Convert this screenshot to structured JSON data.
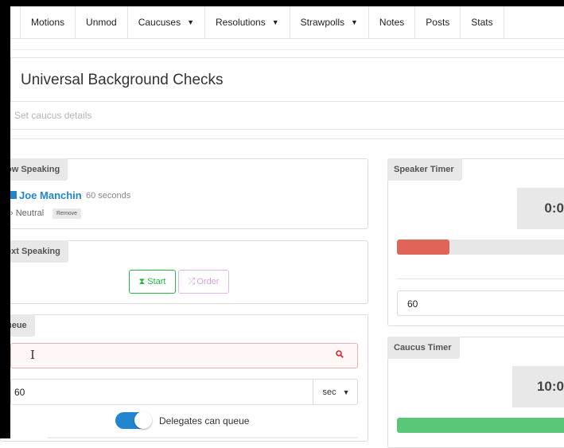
{
  "nav": {
    "items": [
      "Motions",
      "Unmod",
      "Caucuses",
      "Resolutions",
      "Strawpolls",
      "Notes",
      "Posts",
      "Stats"
    ]
  },
  "caucus": {
    "title": "Universal Background Checks",
    "details_placeholder": "Set caucus details"
  },
  "now_speaking": {
    "label": "ow Speaking",
    "speaker": "Joe Manchin",
    "duration": "60 seconds",
    "stance": "Neutral",
    "remove_label": "Remove"
  },
  "next_speaking": {
    "label": "ext Speaking",
    "start_label": "Start",
    "order_label": "Order"
  },
  "queue": {
    "label": "ueue",
    "duration_value": "60",
    "unit": "sec",
    "toggle_label": "Delegates can queue",
    "toggle_on": true
  },
  "speaker_timer": {
    "label": "Speaker Timer",
    "display": "0:0",
    "progress": 0.3,
    "bar_color": "#e06458",
    "input_value": "60"
  },
  "caucus_timer": {
    "label": "Caucus Timer",
    "display": "10:0",
    "progress": 1.0,
    "bar_color": "#5ac677"
  },
  "colors": {
    "accent": "#2185d0",
    "start": "#21ba45",
    "order": "#d6a3e0",
    "error_bg": "#fff6f6"
  }
}
